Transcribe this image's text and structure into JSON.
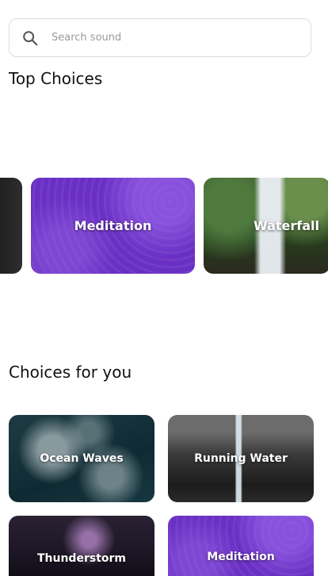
{
  "search": {
    "placeholder": "Search sound"
  },
  "sections": {
    "top_choices": {
      "title": "Top Choices",
      "cards": [
        {
          "label": ""
        },
        {
          "label": "Meditation"
        },
        {
          "label": "Waterfall"
        }
      ]
    },
    "choices_for_you": {
      "title": "Choices for you",
      "cards": [
        {
          "label": "Ocean Waves"
        },
        {
          "label": "Running Water"
        },
        {
          "label": "Thunderstorm"
        },
        {
          "label": "Meditation"
        }
      ]
    }
  },
  "colors": {
    "accent_purple": "#6a2fc4",
    "border": "#dcdcdc"
  }
}
